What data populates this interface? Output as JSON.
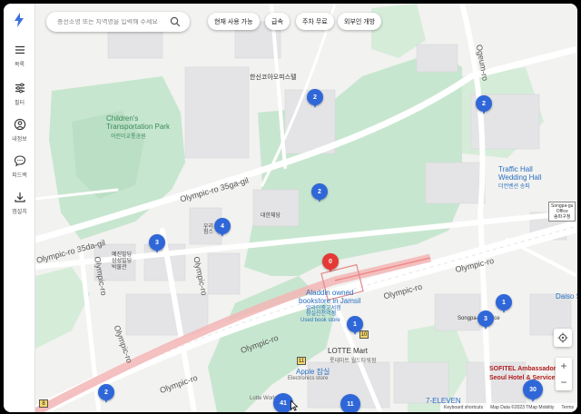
{
  "sidebar": {
    "items": [
      {
        "label": "목록",
        "icon": "menu-icon"
      },
      {
        "label": "필터",
        "icon": "filter-icon"
      },
      {
        "label": "내정보",
        "icon": "user-icon"
      },
      {
        "label": "피드백",
        "icon": "chat-icon"
      },
      {
        "label": "앱설치",
        "icon": "download-icon"
      }
    ]
  },
  "search": {
    "placeholder": "충전소명 또는 지역명을 입력해 주세요"
  },
  "filters": [
    {
      "label": "현재 사용 가능"
    },
    {
      "label": "급속"
    },
    {
      "label": "주차 무료"
    },
    {
      "label": "외부인 개방"
    }
  ],
  "map_labels": {
    "olympic_35_gil": "Olympic-ro 35ga-gil",
    "olympic_35da_gil": "Olympic-ro 35da-gil",
    "olympic_ro_1": "Olympic-ro",
    "olympic_ro_2": "Olympic-ro",
    "olympic_ro_3": "Olympic-ro",
    "olympic_ro_4": "Olympic-ro",
    "olympic_ro_5": "Olympic-ro",
    "olympic_ro_6": "Olympic-ro",
    "ogeum_ro": "Ogeum-ro",
    "childrens_park": "Children's\nTransportation Park",
    "childrens_park_kr": "어린이교통공원",
    "hanshin_apt": "한신코아오피스텔",
    "traffic_hall": "Traffic Hall\nWedding Hall",
    "traffic_hall_kr": "더컨벤션 송파",
    "songpa_office": "Songpa-gu\nOffice\n송파구청",
    "aladdin": "Aladdin owned\nbookstore in Jamsil",
    "aladdin_kr": "알라딘중고서점\n잠실신천역점",
    "used_book": "Used book store",
    "apple": "Apple 잠실",
    "apple_sub": "Electronics store",
    "lotte_mart": "LOTTE Mart",
    "lotte_mart_kr": "롯데마트 월드타워점",
    "lotte_world_mall": "Lotte World Mall",
    "seven_eleven": "7-ELEVEN",
    "sofitel": "SOFITEL Ambassador\nSeoul Hotel & Service",
    "daiso": "Daiso Se",
    "songpa_gu_office": "Songpa-gu Office",
    "daehan": "대한체당",
    "woori": "우리\n힘스",
    "yepjin": "예진빌딩\n삼성빌딩\n박물관"
  },
  "markers": [
    {
      "count": "2"
    },
    {
      "count": "2"
    },
    {
      "count": "2"
    },
    {
      "count": "4"
    },
    {
      "count": "3"
    },
    {
      "count": "0"
    },
    {
      "count": "1"
    },
    {
      "count": "1"
    },
    {
      "count": "3"
    },
    {
      "count": "2"
    },
    {
      "count": "41"
    },
    {
      "count": "11"
    },
    {
      "count": "30"
    }
  ],
  "exits": {
    "e10": "10",
    "e11": "11",
    "e8": "8"
  },
  "controls": {
    "zoom_in": "+",
    "zoom_out": "−"
  },
  "attribution": {
    "shortcuts": "Keyboard shortcuts",
    "mapdata": "Map Data ©2023 TMap Mobility",
    "terms": "Terms"
  },
  "colors": {
    "accent": "#2f67d8",
    "marker_red": "#e53935",
    "park": "#c7e6cf",
    "rail": "#f3b5b5"
  }
}
